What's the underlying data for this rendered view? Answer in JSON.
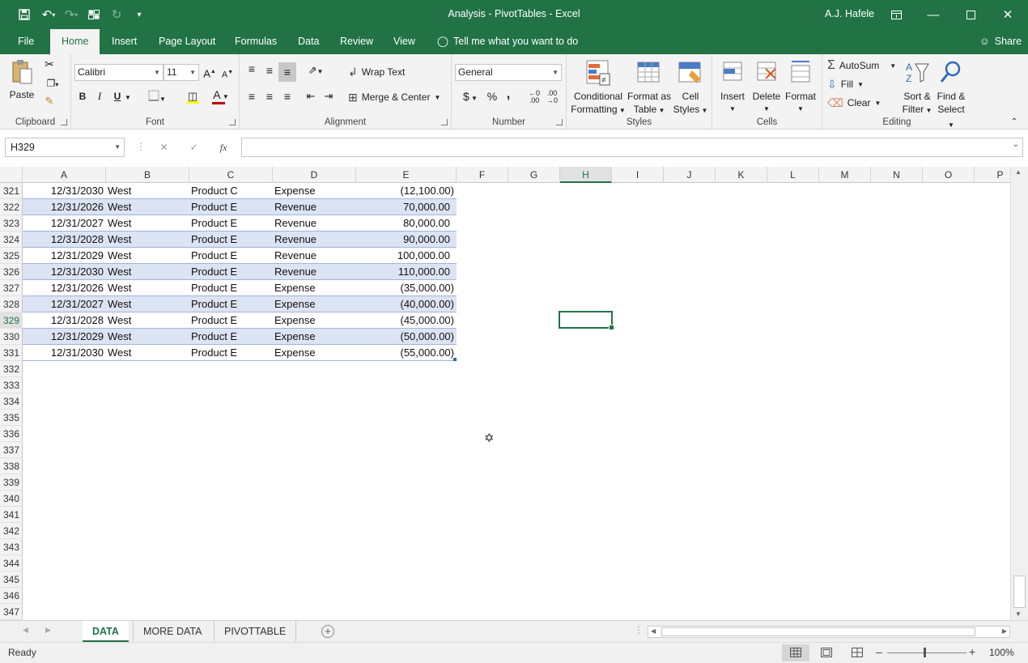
{
  "titlebar": {
    "title": "Analysis - PivotTables  -  Excel",
    "user": "A.J. Hafele"
  },
  "ribbon_tabs": [
    "File",
    "Home",
    "Insert",
    "Page Layout",
    "Formulas",
    "Data",
    "Review",
    "View"
  ],
  "tell_me": "Tell me what you want to do",
  "share": "Share",
  "clipboard": {
    "paste": "Paste",
    "label": "Clipboard"
  },
  "font": {
    "name": "Calibri",
    "size": "11",
    "label": "Font",
    "bold": "B",
    "italic": "I",
    "underline": "U"
  },
  "alignment": {
    "wrap": "Wrap Text",
    "merge": "Merge & Center",
    "label": "Alignment"
  },
  "number": {
    "format": "General",
    "label": "Number",
    "currency": "$",
    "percent": "%",
    "comma": ","
  },
  "styles": {
    "cond_line1": "Conditional",
    "cond_line2": "Formatting",
    "fmt_line1": "Format as",
    "fmt_line2": "Table",
    "cell_line1": "Cell",
    "cell_line2": "Styles",
    "label": "Styles"
  },
  "cells": {
    "insert": "Insert",
    "delete": "Delete",
    "format": "Format",
    "label": "Cells"
  },
  "editing": {
    "autosum": "AutoSum",
    "fill": "Fill",
    "clear": "Clear",
    "sort_line1": "Sort &",
    "sort_line2": "Filter",
    "find_line1": "Find &",
    "find_line2": "Select",
    "label": "Editing"
  },
  "formula_bar": {
    "name_box": "H329",
    "fx": "fx",
    "value": ""
  },
  "columns": [
    "A",
    "B",
    "C",
    "D",
    "E",
    "F",
    "G",
    "H",
    "I",
    "J",
    "K",
    "L",
    "M",
    "N",
    "O",
    "P"
  ],
  "rows": [
    {
      "num": "321",
      "a": "12/31/2030",
      "b": "West",
      "c": "Product C",
      "d": "Expense",
      "e": "(12,100.00)"
    },
    {
      "num": "322",
      "a": "12/31/2026",
      "b": "West",
      "c": "Product E",
      "d": "Revenue",
      "e": "70,000.00"
    },
    {
      "num": "323",
      "a": "12/31/2027",
      "b": "West",
      "c": "Product E",
      "d": "Revenue",
      "e": "80,000.00"
    },
    {
      "num": "324",
      "a": "12/31/2028",
      "b": "West",
      "c": "Product E",
      "d": "Revenue",
      "e": "90,000.00"
    },
    {
      "num": "325",
      "a": "12/31/2029",
      "b": "West",
      "c": "Product E",
      "d": "Revenue",
      "e": "100,000.00"
    },
    {
      "num": "326",
      "a": "12/31/2030",
      "b": "West",
      "c": "Product E",
      "d": "Revenue",
      "e": "110,000.00"
    },
    {
      "num": "327",
      "a": "12/31/2026",
      "b": "West",
      "c": "Product E",
      "d": "Expense",
      "e": "(35,000.00)"
    },
    {
      "num": "328",
      "a": "12/31/2027",
      "b": "West",
      "c": "Product E",
      "d": "Expense",
      "e": "(40,000.00)"
    },
    {
      "num": "329",
      "a": "12/31/2028",
      "b": "West",
      "c": "Product E",
      "d": "Expense",
      "e": "(45,000.00)"
    },
    {
      "num": "330",
      "a": "12/31/2029",
      "b": "West",
      "c": "Product E",
      "d": "Expense",
      "e": "(50,000.00)"
    },
    {
      "num": "331",
      "a": "12/31/2030",
      "b": "West",
      "c": "Product E",
      "d": "Expense",
      "e": "(55,000.00)"
    }
  ],
  "empty_rows": [
    "332",
    "333",
    "334",
    "335",
    "336",
    "337",
    "338",
    "339",
    "340",
    "341",
    "342",
    "343",
    "344",
    "345",
    "346",
    "347"
  ],
  "sheets": [
    "DATA",
    "MORE DATA",
    "PIVOTTABLE"
  ],
  "status": {
    "ready": "Ready",
    "zoom": "100%"
  },
  "colors": {
    "accent": "#217346",
    "band": "#dce3f2"
  }
}
